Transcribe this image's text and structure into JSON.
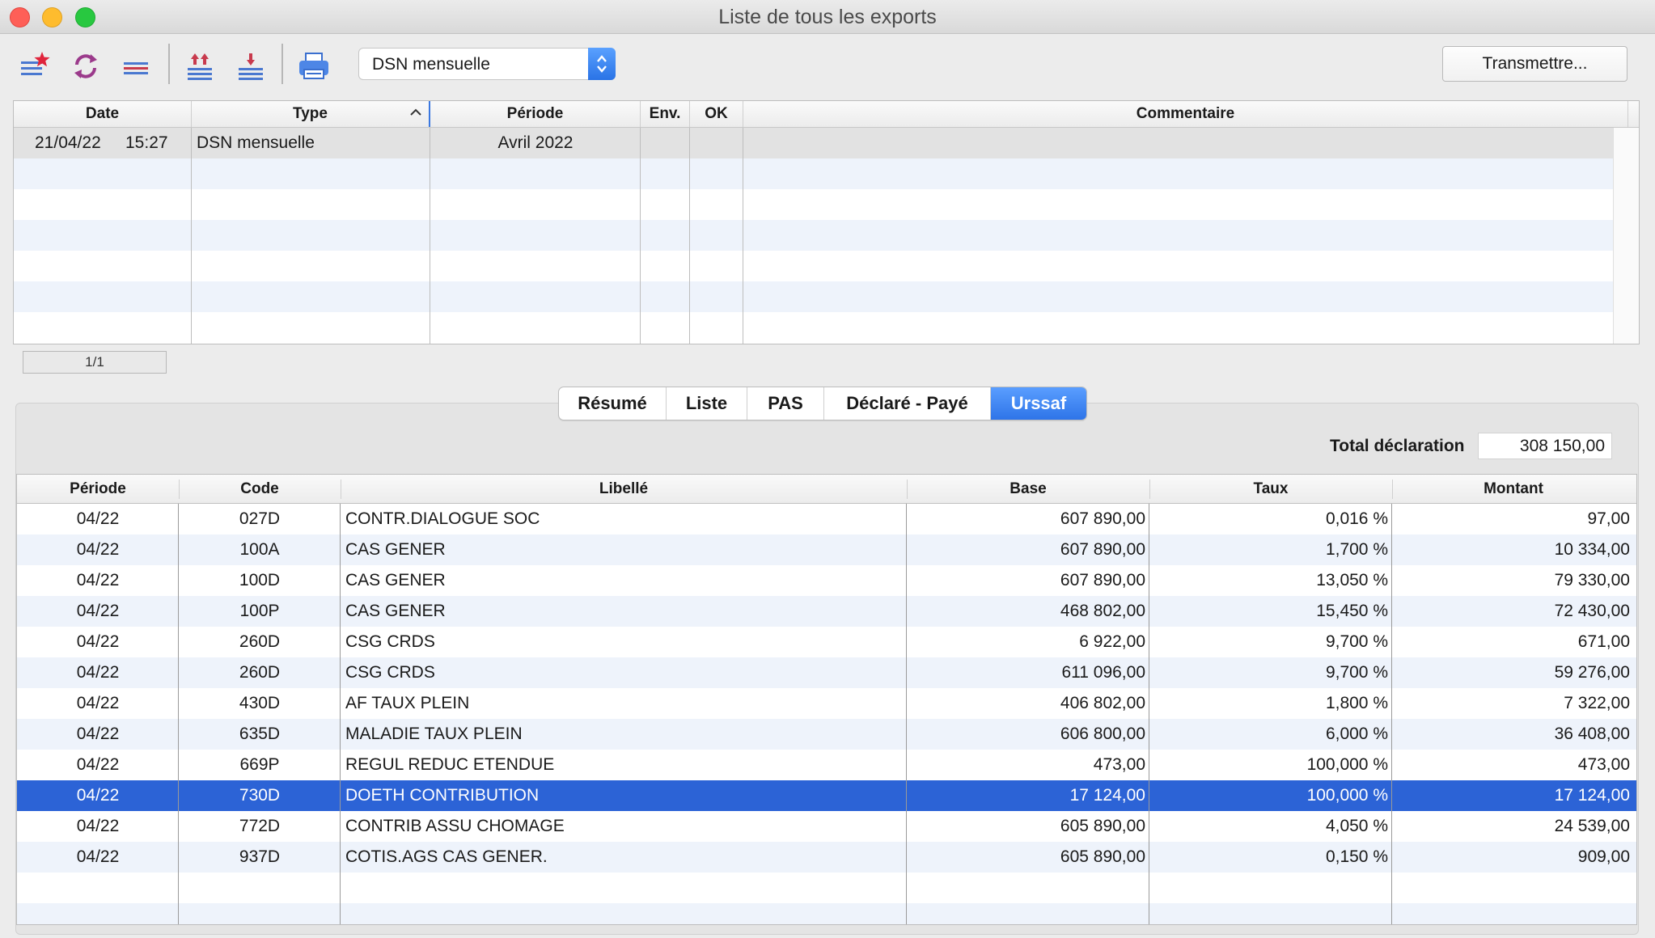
{
  "window": {
    "title": "Liste de tous les exports"
  },
  "toolbar": {
    "icons": [
      "new-star-list-icon",
      "refresh-icon",
      "list-lines-icon",
      "export-up-icon",
      "import-down-icon",
      "print-icon"
    ],
    "export_type_select": {
      "value": "DSN mensuelle"
    },
    "transmit_label": "Transmettre..."
  },
  "exports_table": {
    "columns": [
      "Date",
      "Type",
      "Période",
      "Env.",
      "OK",
      "Commentaire"
    ],
    "rows": [
      {
        "date": "21/04/22",
        "time": "15:27",
        "type": "DSN mensuelle",
        "periode": "Avril 2022",
        "env": "",
        "ok": "",
        "commentaire": ""
      }
    ],
    "pager": "1/1"
  },
  "tabs": [
    "Résumé",
    "Liste",
    "PAS",
    "Déclaré - Payé",
    "Urssaf"
  ],
  "active_tab": "Urssaf",
  "total": {
    "label": "Total déclaration",
    "value": "308 150,00"
  },
  "urssaf_table": {
    "columns": [
      "Période",
      "Code",
      "Libellé",
      "Base",
      "Taux",
      "Montant"
    ],
    "rows": [
      {
        "periode": "04/22",
        "code": "027D",
        "libelle": "CONTR.DIALOGUE SOC",
        "base": "607 890,00",
        "taux": "0,016 %",
        "montant": "97,00"
      },
      {
        "periode": "04/22",
        "code": "100A",
        "libelle": "CAS GENER",
        "base": "607 890,00",
        "taux": "1,700 %",
        "montant": "10 334,00"
      },
      {
        "periode": "04/22",
        "code": "100D",
        "libelle": "CAS GENER",
        "base": "607 890,00",
        "taux": "13,050 %",
        "montant": "79 330,00"
      },
      {
        "periode": "04/22",
        "code": "100P",
        "libelle": "CAS GENER",
        "base": "468 802,00",
        "taux": "15,450 %",
        "montant": "72 430,00"
      },
      {
        "periode": "04/22",
        "code": "260D",
        "libelle": "CSG CRDS",
        "base": "6 922,00",
        "taux": "9,700 %",
        "montant": "671,00"
      },
      {
        "periode": "04/22",
        "code": "260D",
        "libelle": "CSG CRDS",
        "base": "611 096,00",
        "taux": "9,700 %",
        "montant": "59 276,00"
      },
      {
        "periode": "04/22",
        "code": "430D",
        "libelle": "AF TAUX PLEIN",
        "base": "406 802,00",
        "taux": "1,800 %",
        "montant": "7 322,00"
      },
      {
        "periode": "04/22",
        "code": "635D",
        "libelle": "MALADIE TAUX PLEIN",
        "base": "606 800,00",
        "taux": "6,000 %",
        "montant": "36 408,00"
      },
      {
        "periode": "04/22",
        "code": "669P",
        "libelle": "REGUL REDUC ETENDUE",
        "base": "473,00",
        "taux": "100,000 %",
        "montant": "473,00"
      },
      {
        "periode": "04/22",
        "code": "730D",
        "libelle": "DOETH CONTRIBUTION",
        "base": "17 124,00",
        "taux": "100,000 %",
        "montant": "17 124,00",
        "selected": true
      },
      {
        "periode": "04/22",
        "code": "772D",
        "libelle": "CONTRIB ASSU CHOMAGE",
        "base": "605 890,00",
        "taux": "4,050 %",
        "montant": "24 539,00"
      },
      {
        "periode": "04/22",
        "code": "937D",
        "libelle": "COTIS.AGS CAS GENER.",
        "base": "605 890,00",
        "taux": "0,150 %",
        "montant": "909,00"
      }
    ]
  },
  "colors": {
    "selection": "#2c63d6",
    "accent": "#2e74e8",
    "row_alt": "#eef3fb"
  }
}
